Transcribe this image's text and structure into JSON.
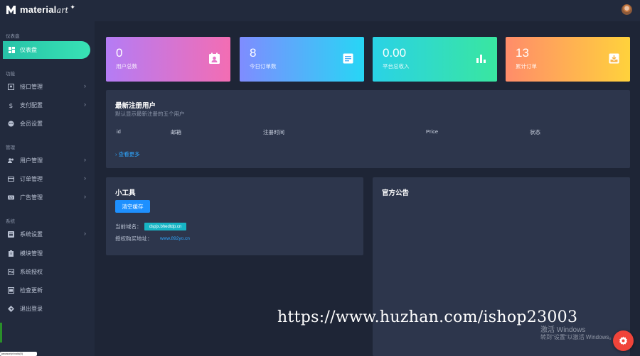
{
  "app": {
    "logo_text": "material",
    "logo_suffix": "art",
    "logo_sparkle": "✦"
  },
  "sidebar": {
    "sections": {
      "dashboard": "仪表盘",
      "features": "功能",
      "management": "管理",
      "system": "系统"
    },
    "active_item": {
      "label": "仪表盘",
      "icon": "dashboard-icon"
    },
    "items": [
      {
        "label": "接口管理",
        "icon": "interface-icon",
        "has_submenu": true
      },
      {
        "label": "支付配置",
        "icon": "dollar-icon",
        "has_submenu": true
      },
      {
        "label": "会员设置",
        "icon": "face-icon",
        "has_submenu": false
      },
      {
        "label": "用户管理",
        "icon": "users-icon",
        "has_submenu": true
      },
      {
        "label": "订单管理",
        "icon": "card-icon",
        "has_submenu": true
      },
      {
        "label": "广告管理",
        "icon": "ad-icon",
        "has_submenu": true
      },
      {
        "label": "系统设置",
        "icon": "list-icon",
        "has_submenu": true
      },
      {
        "label": "模块管理",
        "icon": "clipboard-icon",
        "has_submenu": false
      },
      {
        "label": "系统授权",
        "icon": "license-icon",
        "has_submenu": false
      },
      {
        "label": "检查更新",
        "icon": "update-icon",
        "has_submenu": false
      },
      {
        "label": "退出登录",
        "icon": "logout-icon",
        "has_submenu": false
      }
    ],
    "chevron": "›"
  },
  "stats": [
    {
      "value": "0",
      "label": "用户总数",
      "icon": "contact-icon",
      "gradient": [
        "#b47cf5",
        "#f36db3"
      ]
    },
    {
      "value": "8",
      "label": "今日订单数",
      "icon": "document-icon",
      "gradient": [
        "#7f8cff",
        "#27d6f5"
      ]
    },
    {
      "value": "0.00",
      "label": "平台总收入",
      "icon": "bar-chart-icon",
      "gradient": [
        "#2ad2e6",
        "#39e6a0"
      ]
    },
    {
      "value": "13",
      "label": "累计订单",
      "icon": "inbox-icon",
      "gradient": [
        "#ff8c6a",
        "#ffd23c"
      ]
    }
  ],
  "users_panel": {
    "title": "最新注册用户",
    "subtitle": "默认显示最新注册的五个用户",
    "columns": [
      "id",
      "邮箱",
      "注册时间",
      "Price",
      "状态"
    ],
    "more_link": "› 查看更多"
  },
  "tools_panel": {
    "title": "小工具",
    "clear_cache_button": "清空缓存",
    "domain_label": "当前域名：",
    "domain_value": "dspjx.bhedtdp.cn",
    "auth_label": "授权购买地址：",
    "auth_link": "www.892yo.cn"
  },
  "notice_panel": {
    "title": "官方公告"
  },
  "overlay": {
    "watermark": "https://www.huzhan.com/ishop23003",
    "activate_title": "激活 Windows",
    "activate_hint": "转到\"设置\"以激活 Windows。"
  },
  "status_chip": "javascript:void(0)",
  "colors": {
    "accent": "#2ed3b0",
    "link": "#2ea7ff",
    "fab": "#f0443a",
    "panel": "#2d364c",
    "background": "#1e2536"
  }
}
